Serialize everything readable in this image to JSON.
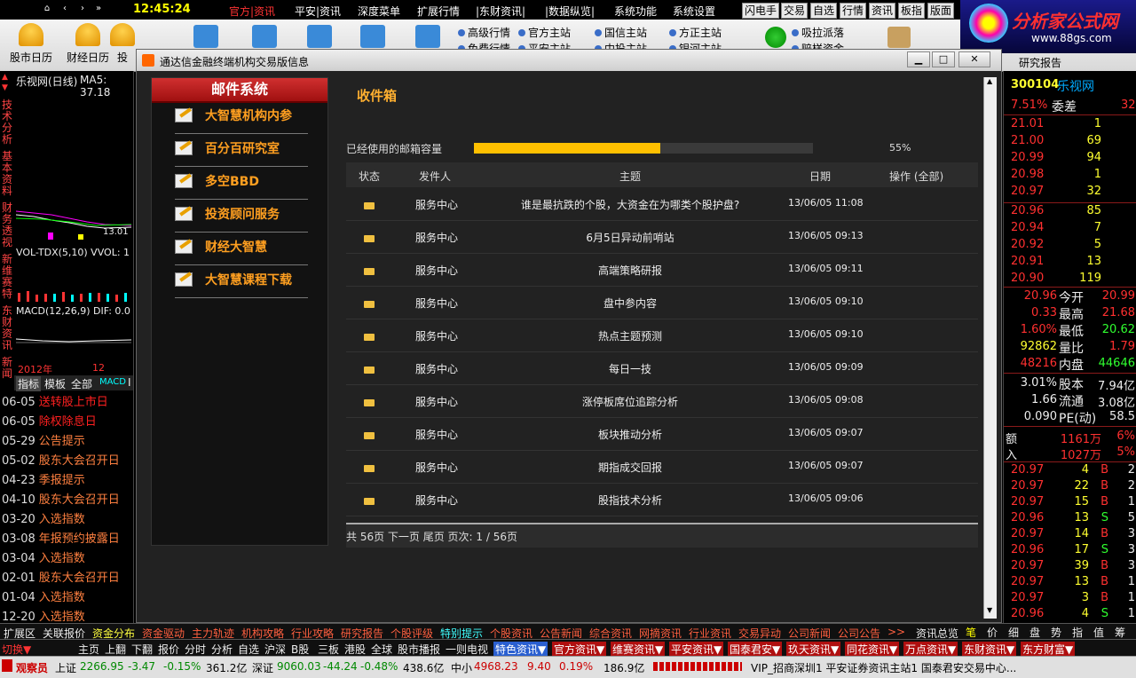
{
  "topbar": {
    "clock": "12:45:24",
    "menus": [
      {
        "label": "官方|资讯",
        "active": true
      },
      {
        "label": "平安|资讯",
        "active": false
      },
      {
        "label": "深度菜单",
        "active": false
      },
      {
        "label": "扩展行情",
        "active": false
      },
      {
        "label": "|东财资讯|",
        "active": false
      },
      {
        "label": "|数据纵览|",
        "active": false
      },
      {
        "label": "系统功能",
        "active": false
      },
      {
        "label": "系统设置",
        "active": false
      }
    ],
    "quick": [
      "闪电手",
      "交易",
      "自选",
      "行情",
      "资讯",
      "板指",
      "版面"
    ]
  },
  "toolbar": {
    "tools": [
      "股市日历",
      "财经日历",
      "投"
    ],
    "links": [
      "高级行情",
      "免费行情",
      "官方主站",
      "平安主站",
      "国信主站",
      "中投主站",
      "方正主站",
      "银河主站",
      "吸拉派落",
      "赔样资金"
    ]
  },
  "logo": {
    "title": "分析家公式网",
    "url_text": "www.88gs.com"
  },
  "research": "研究报告",
  "chart": {
    "name_label": "乐视网(日线)",
    "ma_label": "MA5: 37.18",
    "price_tick": "13.01",
    "vol_label": "VOL-TDX(5,10)  VVOL: 1",
    "macd_label": "MACD(12,26,9)  DIF: 0.0",
    "year_label": "2012年",
    "month_label": "12",
    "tabs": [
      "指标",
      "模板",
      "全部",
      "MACD",
      "I"
    ],
    "side_tabs": [
      "技术分析",
      "基本资料",
      "财务透视",
      "新维赛特",
      "东财资讯",
      "新闻"
    ]
  },
  "news": [
    {
      "date": "06-05",
      "title": "送转股上市日",
      "highlight": true
    },
    {
      "date": "06-05",
      "title": "除权除息日",
      "highlight": true
    },
    {
      "date": "05-29",
      "title": "公告提示",
      "highlight": false
    },
    {
      "date": "05-02",
      "title": "股东大会召开日",
      "highlight": false
    },
    {
      "date": "04-23",
      "title": "季报提示",
      "highlight": false
    },
    {
      "date": "04-10",
      "title": "股东大会召开日",
      "highlight": false
    },
    {
      "date": "03-20",
      "title": "入选指数",
      "highlight": false
    },
    {
      "date": "03-08",
      "title": "年报预约披露日",
      "highlight": false
    },
    {
      "date": "03-04",
      "title": "入选指数",
      "highlight": false
    },
    {
      "date": "02-01",
      "title": "股东大会召开日",
      "highlight": false
    },
    {
      "date": "01-04",
      "title": "入选指数",
      "highlight": false
    },
    {
      "date": "12-20",
      "title": "入选指数",
      "highlight": false
    }
  ],
  "dialog": {
    "title": "通达信金融终端机构交易版信息",
    "mail_system": "邮件系统",
    "categories": [
      "大智慧机构内参",
      "百分百研究室",
      "多空BBD",
      "投资顾问服务",
      "财经大智慧",
      "大智慧课程下载"
    ],
    "inbox_title": "收件箱",
    "quota_label": "已经使用的邮箱容量",
    "quota_percent": 55,
    "quota_text": "55%",
    "columns": [
      "状态",
      "发件人",
      "主题",
      "日期",
      "操作 (全部)"
    ],
    "rows": [
      {
        "sender": "服务中心",
        "subject": "谁是最抗跌的个股，大资金在为哪类个股护盘?",
        "date": "13/06/05 11:08"
      },
      {
        "sender": "服务中心",
        "subject": "6月5日异动前哨站",
        "date": "13/06/05 09:13"
      },
      {
        "sender": "服务中心",
        "subject": "高端策略研报",
        "date": "13/06/05 09:11"
      },
      {
        "sender": "服务中心",
        "subject": "盘中参内容",
        "date": "13/06/05 09:10"
      },
      {
        "sender": "服务中心",
        "subject": "热点主题预测",
        "date": "13/06/05 09:10"
      },
      {
        "sender": "服务中心",
        "subject": "每日一技",
        "date": "13/06/05 09:09"
      },
      {
        "sender": "服务中心",
        "subject": "涨停板席位追踪分析",
        "date": "13/06/05 09:08"
      },
      {
        "sender": "服务中心",
        "subject": "板块推动分析",
        "date": "13/06/05 09:07"
      },
      {
        "sender": "服务中心",
        "subject": "期指成交回报",
        "date": "13/06/05 09:07"
      },
      {
        "sender": "服务中心",
        "subject": "股指技术分析",
        "date": "13/06/05 09:06"
      }
    ],
    "pager": "共 56页  下一页  尾页  页次: 1 / 56页"
  },
  "quote": {
    "code": "300104",
    "name": "乐视网",
    "wb_pct": "7.51%",
    "wb_label": "委差",
    "wb_val": "32",
    "asks": [
      [
        "21.01",
        "1"
      ],
      [
        "21.00",
        "69"
      ],
      [
        "20.99",
        "94"
      ],
      [
        "20.98",
        "1"
      ],
      [
        "20.97",
        "32"
      ]
    ],
    "bids": [
      [
        "20.96",
        "85"
      ],
      [
        "20.94",
        "7"
      ],
      [
        "20.92",
        "5"
      ],
      [
        "20.91",
        "13"
      ],
      [
        "20.90",
        "119"
      ]
    ],
    "stats": [
      {
        "a": "20.96",
        "l": "今开",
        "b": "20.99",
        "ac": "red",
        "bc": "red"
      },
      {
        "a": "0.33",
        "l": "最高",
        "b": "21.68",
        "ac": "red",
        "bc": "red"
      },
      {
        "a": "1.60%",
        "l": "最低",
        "b": "20.62",
        "ac": "red",
        "bc": "grn"
      },
      {
        "a": "92862",
        "l": "量比",
        "b": "1.79",
        "ac": "yel",
        "bc": "red"
      },
      {
        "a": "48216",
        "l": "内盘",
        "b": "44646",
        "ac": "red",
        "bc": "grn"
      }
    ],
    "fund": [
      {
        "a": "3.01%",
        "l": "股本",
        "b": "7.94亿"
      },
      {
        "a": "1.66",
        "l": "流通",
        "b": "3.08亿"
      },
      {
        "a": "0.090",
        "l": "PE(动)",
        "b": "58.5"
      }
    ],
    "flow": [
      {
        "l": "额",
        "v": "1161万",
        "p": "6%"
      },
      {
        "l": "入",
        "v": "1027万",
        "p": "5%"
      }
    ],
    "ticks": [
      [
        "20.97",
        "4",
        "B",
        "2"
      ],
      [
        "20.97",
        "22",
        "B",
        "2"
      ],
      [
        "20.97",
        "15",
        "B",
        "1"
      ],
      [
        "20.96",
        "13",
        "S",
        "5"
      ],
      [
        "20.97",
        "14",
        "B",
        "3"
      ],
      [
        "20.96",
        "17",
        "S",
        "3"
      ],
      [
        "20.97",
        "39",
        "B",
        "3"
      ],
      [
        "20.97",
        "13",
        "B",
        "1"
      ],
      [
        "20.97",
        "3",
        "B",
        "1"
      ],
      [
        "20.96",
        "4",
        "S",
        "1"
      ]
    ],
    "bottom_tabs": [
      "笔",
      "价",
      "细",
      "盘",
      "势",
      "指",
      "值",
      "筹"
    ]
  },
  "tabbar1": [
    "扩展区",
    "关联报价",
    "资金分布",
    "资金驱动",
    "主力轨迹",
    "机构攻略",
    "行业攻略",
    "研究报告",
    "个股评级",
    "特别提示",
    "个股资讯",
    "公告新闻",
    "综合资讯",
    "网摘资讯",
    "行业资讯",
    "交易异动",
    "公司新闻",
    "公司公告",
    ">>",
    "资讯总览"
  ],
  "tabbar2": [
    "切换▼",
    "主页",
    "上翻",
    "下翻",
    "报价",
    "分时",
    "分析",
    "自选",
    "沪深",
    "B股",
    "三板",
    "港股",
    "全球",
    "股市播报",
    "一则电视",
    "特色资讯▼",
    "官方资讯▼",
    "维赛资讯▼",
    "平安资讯▼",
    "国泰君安▼",
    "玖天资讯▼",
    "同花资讯▼",
    "万点资讯▼",
    "东财资讯▼",
    "东方财富▼"
  ],
  "status": {
    "user": "观察员",
    "sh_label": "上证",
    "sh_val": "2266.95",
    "sh_chg": "-3.47",
    "sh_pct": "-0.15%",
    "sh_amt": "361.2亿",
    "sz_label": "深证",
    "sz_val": "9060.03",
    "sz_chg": "-44.24",
    "sz_pct": "-0.48%",
    "sz_amt": "438.6亿",
    "zx_label": "中小",
    "zx_val": "4968.23",
    "zx_chg": "9.40",
    "zx_pct": "0.19%",
    "zx_amt": "186.9亿",
    "ticker": "VIP_招商深圳1  平安证券资讯主站1  国泰君安交易中心..."
  }
}
